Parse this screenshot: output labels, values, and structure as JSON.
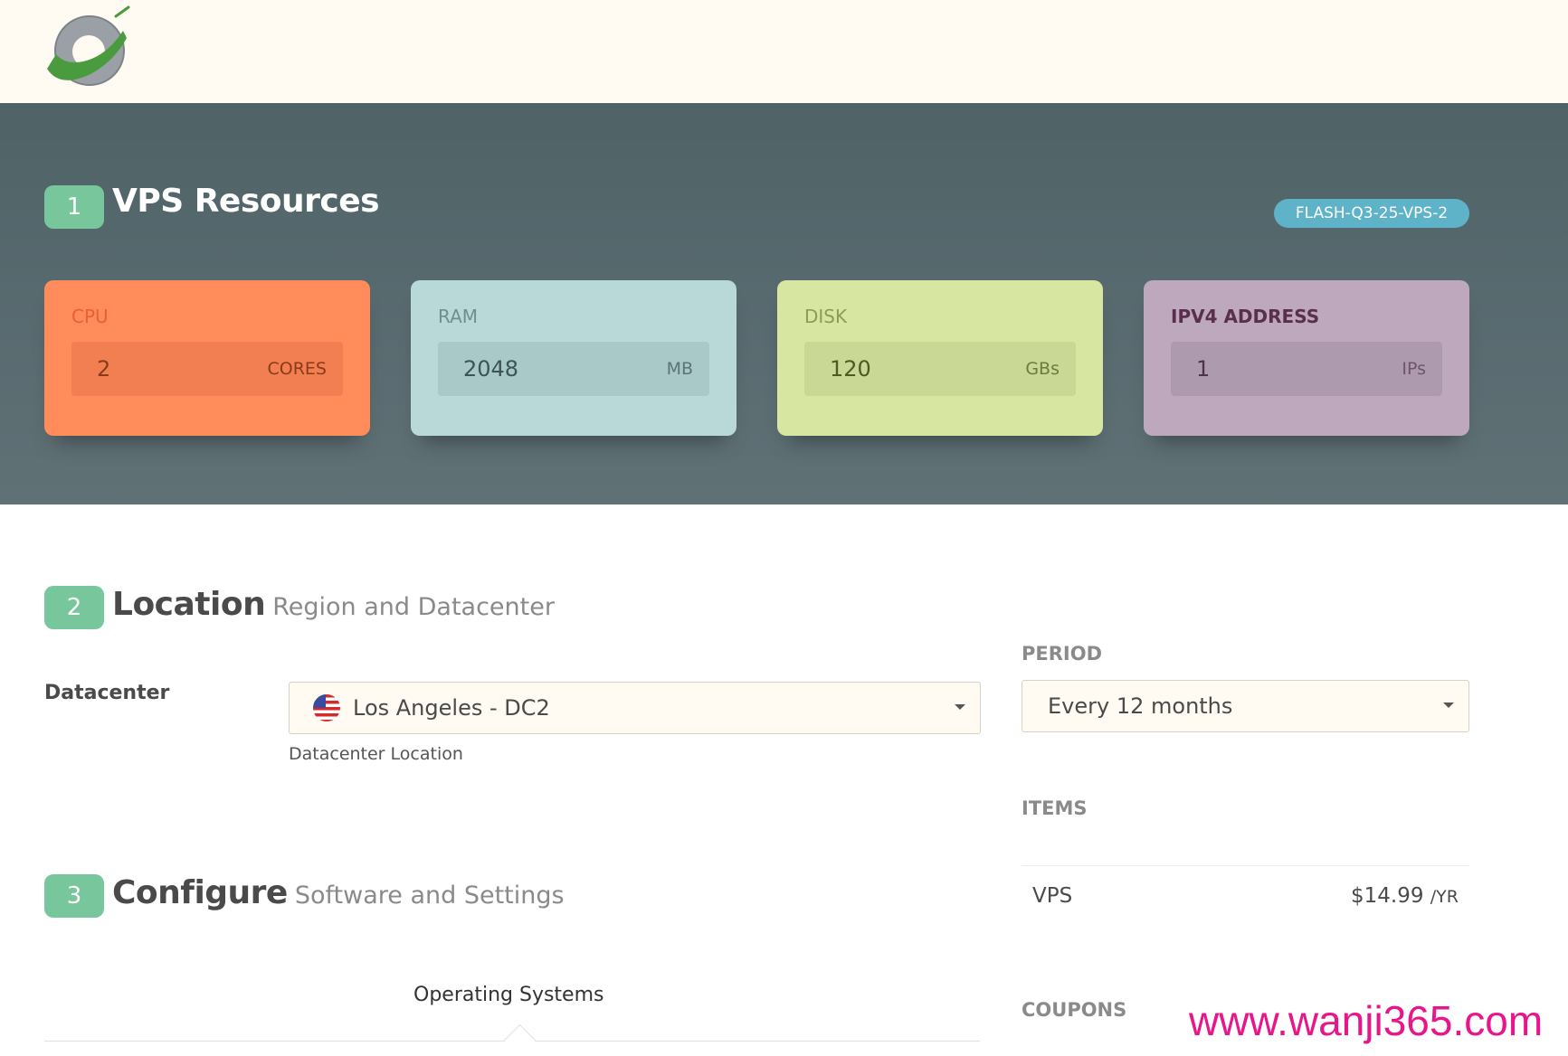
{
  "header": {
    "logo_icon": "swoosh-logo"
  },
  "resources": {
    "step": "1",
    "title": "VPS Resources",
    "promo_code": "FLASH-Q3-25-VPS-2",
    "cpu": {
      "label": "CPU",
      "value": "2",
      "unit": "CORES",
      "color": "#ff8c5a"
    },
    "ram": {
      "label": "RAM",
      "value": "2048",
      "unit": "MB",
      "color": "#b8d9d7"
    },
    "disk": {
      "label": "DISK",
      "value": "120",
      "unit": "GBs",
      "color": "#d7e6a1"
    },
    "ipv4": {
      "label": "IPV4 ADDRESS",
      "value": "1",
      "unit": "IPs",
      "color": "#bda8bd"
    }
  },
  "location": {
    "step": "2",
    "title": "Location",
    "subtitle": "Region and Datacenter",
    "datacenter_label": "Datacenter",
    "datacenter_value": "Los Angeles - DC2",
    "datacenter_flag_icon": "us-flag-icon",
    "datacenter_help": "Datacenter Location"
  },
  "configure": {
    "step": "3",
    "title": "Configure",
    "subtitle": "Software and Settings",
    "tab_os": "Operating Systems"
  },
  "summary": {
    "period_label": "PERIOD",
    "period_value": "Every 12 months",
    "items_label": "ITEMS",
    "items": [
      {
        "name": "VPS",
        "price": "$14.99",
        "per": "/YR"
      }
    ],
    "coupons_label": "COUPONS"
  },
  "watermark": "www.wanji365.com",
  "colors": {
    "accent_green": "#78c69c",
    "hero_bg": "#4f6367",
    "promo": "#5fb3c9"
  }
}
